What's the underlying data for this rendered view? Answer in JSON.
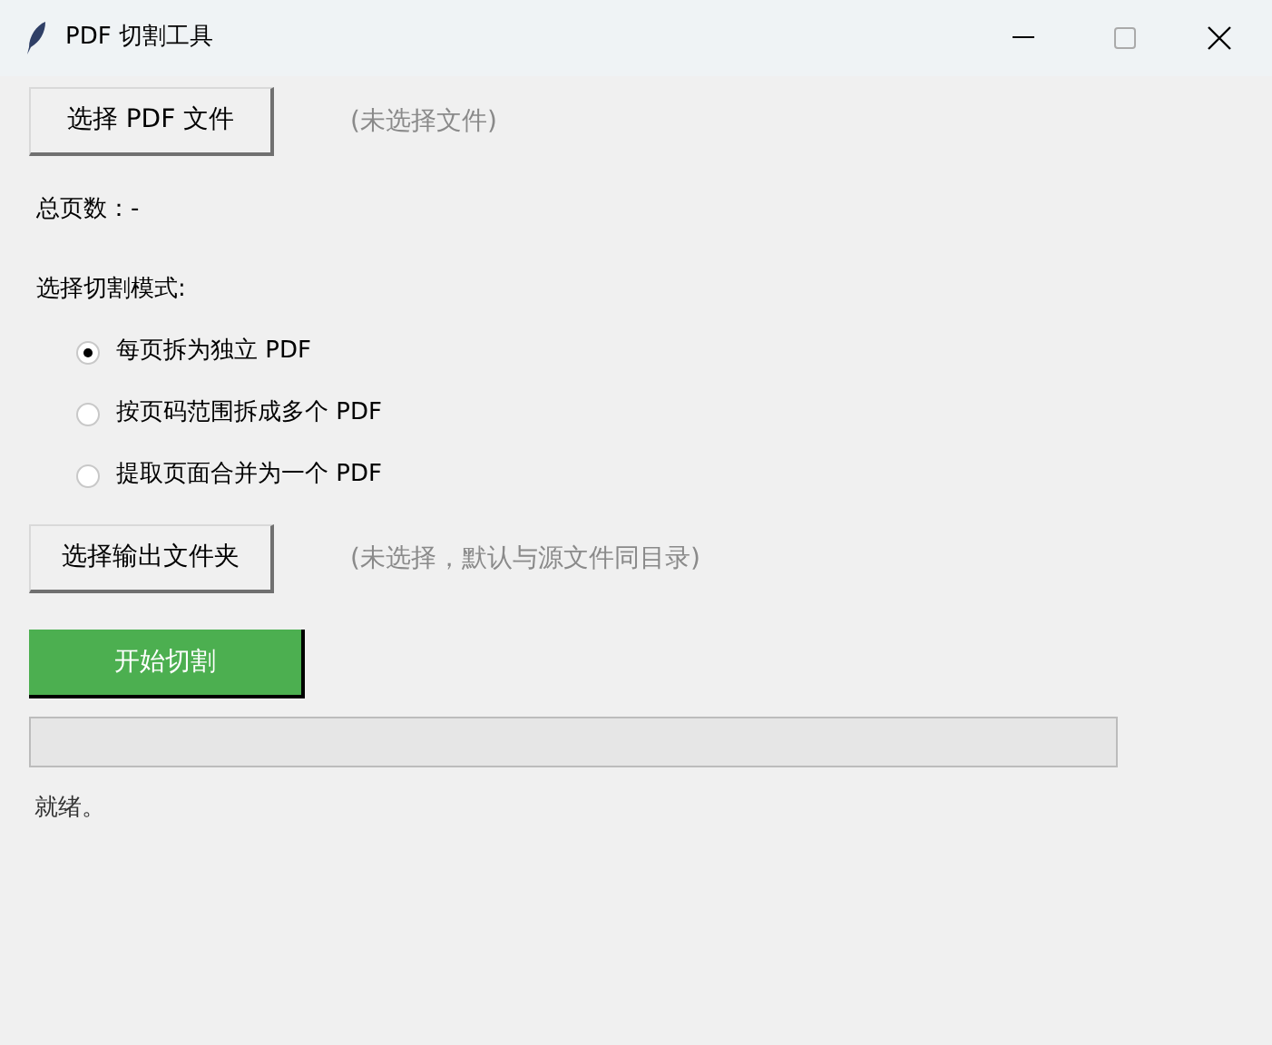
{
  "window": {
    "title": "PDF 切割工具"
  },
  "file_picker": {
    "button": "选择 PDF 文件",
    "status": "(未选择文件)"
  },
  "total_pages": "总页数：-",
  "mode_label": "选择切割模式:",
  "modes": [
    {
      "label": "每页拆为独立 PDF",
      "selected": true
    },
    {
      "label": "按页码范围拆成多个 PDF",
      "selected": false
    },
    {
      "label": "提取页面合并为一个 PDF",
      "selected": false
    }
  ],
  "output_picker": {
    "button": "选择输出文件夹",
    "status": "(未选择，默认与源文件同目录)"
  },
  "start_button": "开始切割",
  "progress": {
    "level": 0
  },
  "status": "就绪。"
}
